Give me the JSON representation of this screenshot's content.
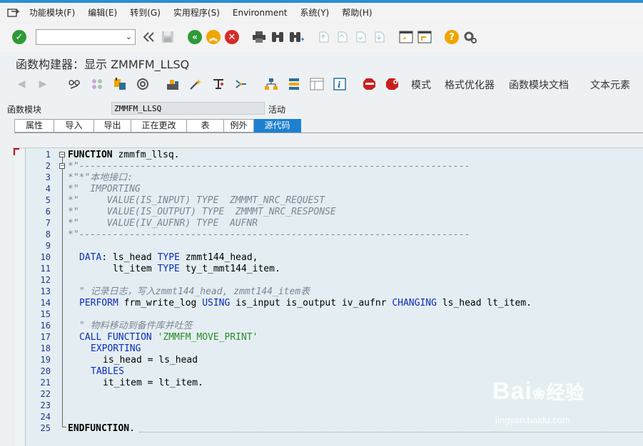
{
  "menubar": {
    "items": [
      "功能模块(F)",
      "编辑(E)",
      "转到(G)",
      "实用程序(S)",
      "Environment",
      "系统(Y)",
      "帮助(H)"
    ]
  },
  "toolbar": {
    "command_field_value": "",
    "icons": [
      "enter-checkmark-icon",
      "back-double-icon",
      "save-icon",
      "back-icon",
      "exit-icon",
      "cancel-icon",
      "print-icon",
      "find-icon",
      "find-next-icon",
      "first-page-icon",
      "prev-page-icon",
      "next-page-icon",
      "last-page-icon",
      "new-session-icon",
      "shortcut-icon",
      "help-icon",
      "settings-icon"
    ]
  },
  "title": "函数构建器：显示 ZMMFM_LLSQ",
  "app_toolbar": {
    "buttons": [
      "模式",
      "格式优化器",
      "函数模块文档",
      "文本元素"
    ]
  },
  "header_field": {
    "label": "函数模块",
    "value": "ZMMFM_LLSQ",
    "status": "活动"
  },
  "tabs": [
    {
      "label": "属性",
      "active": false
    },
    {
      "label": "导入",
      "active": false
    },
    {
      "label": "导出",
      "active": false
    },
    {
      "label": "正在更改",
      "active": false
    },
    {
      "label": "表",
      "active": false
    },
    {
      "label": "例外",
      "active": false
    },
    {
      "label": "源代码",
      "active": true
    }
  ],
  "editor": {
    "line_numbers": [
      "1",
      "2",
      "3",
      "4",
      "5",
      "6",
      "7",
      "8",
      "9",
      "10",
      "11",
      "12",
      "13",
      "14",
      "15",
      "16",
      "17",
      "18",
      "19",
      "20",
      "21",
      "22",
      "23",
      "24",
      "25"
    ],
    "lines": {
      "l1_kw": "FUNCTION",
      "l1_rest": " zmmfm_llsq.",
      "l2": "*\"----------------------------------------------------------------------",
      "l3": "*\"*\"本地接口:",
      "l4": "*\"  IMPORTING",
      "l5": "*\"     VALUE(IS_INPUT) TYPE  ZMMMT_NRC_REQUEST",
      "l6": "*\"     VALUE(IS_OUTPUT) TYPE  ZMMMT_NRC_RESPONSE",
      "l7": "*\"     VALUE(IV_AUFNR) TYPE  AUFNR",
      "l8": "*\"----------------------------------------------------------------------",
      "l10_kw": "DATA",
      "l10_a": ": ls_head ",
      "l10_type": "TYPE",
      "l10_b": " zmmt144_head,",
      "l11_a": "      lt_item ",
      "l11_type": "TYPE",
      "l11_b": " ty_t_mmt144_item.",
      "l13": "\" 记录日志，写入zmmt144_head, zmmt144_item表",
      "l14_kw": "PERFORM",
      "l14_a": " frm_write_log ",
      "l14_using": "USING",
      "l14_b": " is_input is_output iv_aufnr ",
      "l14_changing": "CHANGING",
      "l14_c": " ls_head lt_item.",
      "l16": "\" 物料移动到备件库并吐签",
      "l17_kw": "CALL FUNCTION",
      "l17_str": " 'ZMMFM_MOVE_PRINT'",
      "l18": "EXPORTING",
      "l19": "is_head = ls_head",
      "l20": "TABLES",
      "l21": "it_item = lt_item.",
      "l25_kw": "ENDFUNCTION",
      "l25_rest": "."
    }
  },
  "watermark": {
    "brand": "Bai",
    "brand2": "经验",
    "url": "jingyan.baidu.com"
  }
}
